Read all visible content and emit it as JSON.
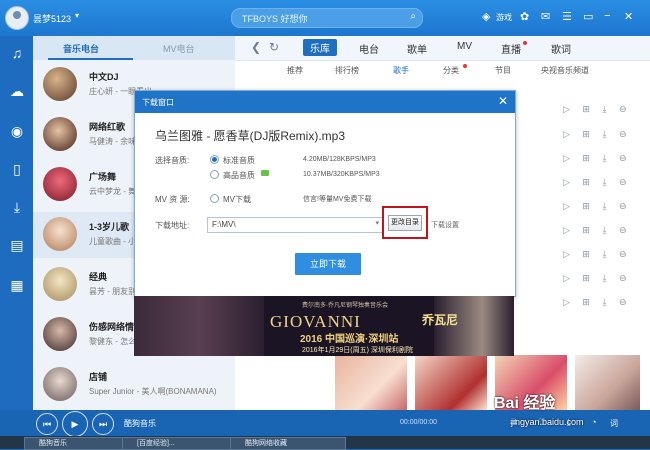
{
  "titlebar": {
    "user_name": "昙梦5123",
    "search_text": "TFBOYS 好想你",
    "game_label": "游戏"
  },
  "left_panel": {
    "tabs": [
      "音乐电台",
      "MV电台"
    ],
    "stations": [
      {
        "title": "中文DJ",
        "subtitle": "庄心妍 - 一眼看出"
      },
      {
        "title": "网络红歌",
        "subtitle": "马健涛 - 余味"
      },
      {
        "title": "广场舞",
        "subtitle": "云中梦龙 - 舞曲"
      },
      {
        "title": "1-3岁儿歌",
        "subtitle": "儿童歌曲 - 小"
      },
      {
        "title": "经典",
        "subtitle": "昙芳 - 朋友别"
      },
      {
        "title": "伤感网络情歌",
        "subtitle": "黎健东 - 怎么"
      },
      {
        "title": "店铺",
        "subtitle": "Super Junior - 美人啊(BONAMANA)"
      }
    ]
  },
  "main": {
    "nav": [
      "乐库",
      "电台",
      "歌单",
      "MV",
      "直播",
      "歌词"
    ],
    "subnav": [
      "推荐",
      "排行榜",
      "歌手",
      "分类",
      "节目",
      "央视音乐频道"
    ]
  },
  "dialog": {
    "title": "下载窗口",
    "song": "乌兰图雅 - 愿香草(DJ版Remix).mp3",
    "quality_label": "选择音质:",
    "opt_standard": "标准音质",
    "opt_high": "高品音质",
    "size_standard": "4.20MB/128KBPS/MP3",
    "size_high": "10.37MB/320KBPS/MP3",
    "mv_label": "MV 资 源:",
    "mv_option": "MV下载",
    "mv_note": "信言!等量MV免费下载",
    "path_label": "下载地址:",
    "path_value": "F:\\MV\\",
    "change_button": "更改目录",
    "settings_link": "下载设置",
    "download_button": "立即下载"
  },
  "banner": {
    "top_text": "费尔南多·乔凡尼钢琴独奏音乐会",
    "title": "GIOVANNI",
    "brand": "乔瓦尼",
    "subtitle": "2016 中国巡演·深圳站",
    "date": "2016年1月29日(周五) 深圳保利剧院"
  },
  "player": {
    "track": "酷狗音乐",
    "time": "00:00/00:00",
    "lyric": "词"
  },
  "taskbar": [
    "酷狗音乐",
    "[百度经验]...",
    "酷狗网络收藏"
  ],
  "watermark": {
    "text": "Bai 经验",
    "url": "jingyan.baidu.com"
  }
}
